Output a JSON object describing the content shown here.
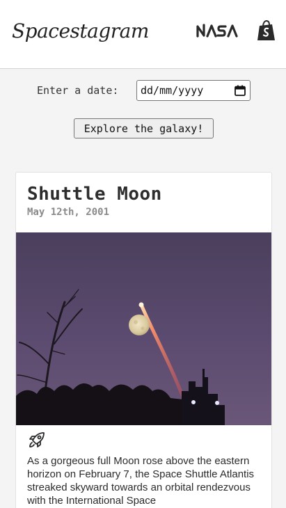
{
  "header": {
    "brand": "Spacestagram",
    "partner_logos": [
      "nasa-logo",
      "shopify-logo"
    ]
  },
  "search": {
    "label": "Enter a date:",
    "date_placeholder": "dd/mm/yyyy",
    "button_label": "Explore the galaxy!"
  },
  "post": {
    "title": "Shuttle Moon",
    "date": "May 12th, 2001",
    "image_subject": "full-moon-and-shuttle-launch-trail",
    "like_icon": "rocket-icon",
    "description": "As a gorgeous full Moon rose above the eastern horizon on February 7, the Space Shuttle Atlantis streaked skyward towards an orbital rendezvous with the International Space"
  },
  "colors": {
    "page_background": "#f4f4f4",
    "header_background": "#ffffff",
    "sky_purple": "#5a4a6b"
  }
}
